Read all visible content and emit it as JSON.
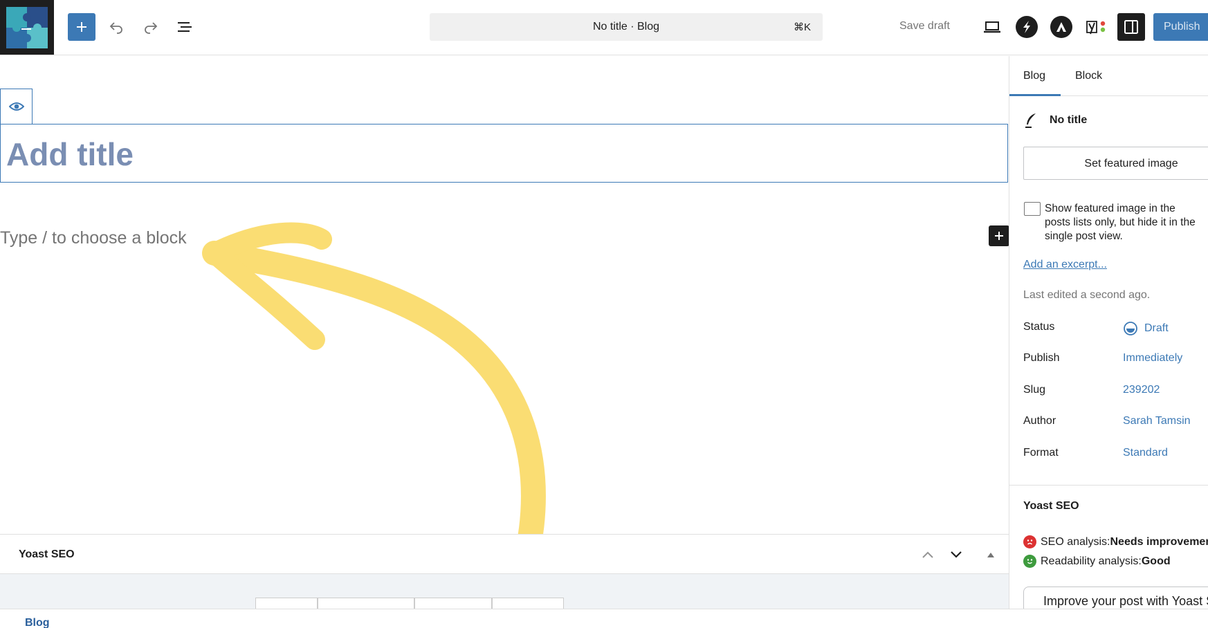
{
  "header": {
    "command_title": "No title · Blog",
    "command_shortcut": "⌘K",
    "save_draft_label": "Save draft",
    "publish_label": "Publish"
  },
  "editor": {
    "title_placeholder": "Add title",
    "block_placeholder": "Type / to choose a block"
  },
  "sidebar": {
    "tabs": [
      "Blog",
      "Block"
    ],
    "post_title": "No title",
    "featured_image_button": "Set featured image",
    "featured_checkbox_label": "Show featured image in the posts lists only, but hide it in the single post view.",
    "excerpt_link": "Add an excerpt...",
    "last_edited": "Last edited a second ago.",
    "meta": [
      {
        "key": "Status",
        "value": "Draft"
      },
      {
        "key": "Publish",
        "value": "Immediately"
      },
      {
        "key": "Slug",
        "value": "239202"
      },
      {
        "key": "Author",
        "value": "Sarah Tamsin"
      },
      {
        "key": "Format",
        "value": "Standard"
      }
    ],
    "yoast_title": "Yoast SEO",
    "seo_label": "SEO analysis: ",
    "seo_value": "Needs improvement",
    "readability_label": "Readability analysis: ",
    "readability_value": "Good",
    "improve_text": "Improve your post with Yoast SEO"
  },
  "yoast_panel": {
    "title": "Yoast SEO"
  },
  "footer": {
    "breadcrumb": "Blog"
  },
  "colors": {
    "accent": "#3c79b5",
    "arrow": "#fadd73",
    "bad": "#dc3232",
    "good": "#3e9b3e"
  }
}
